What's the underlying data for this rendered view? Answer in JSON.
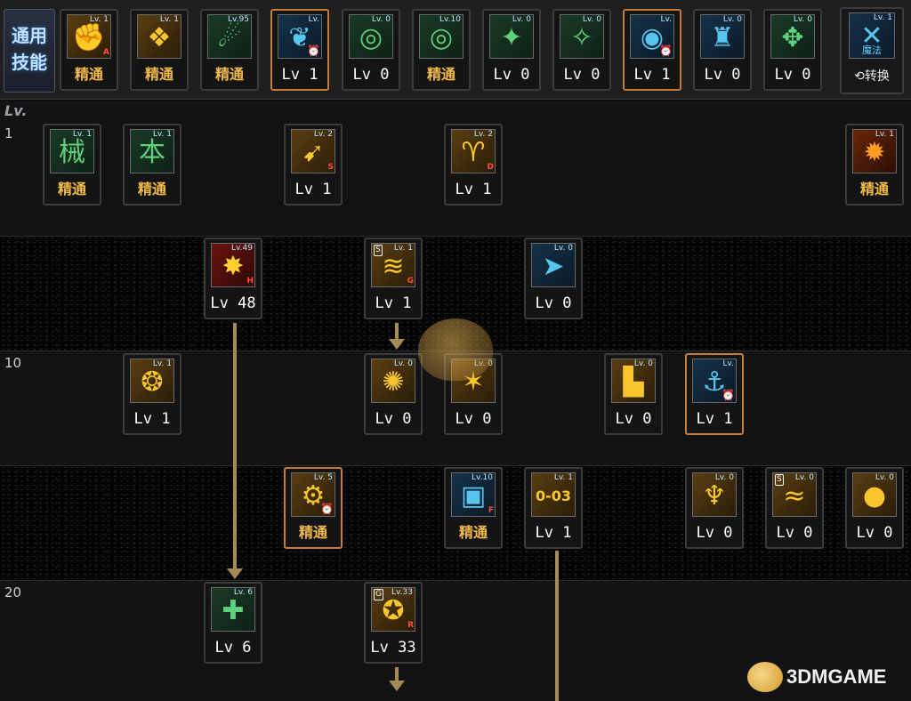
{
  "common_skills": {
    "label_line1": "通用",
    "label_line2": "技能",
    "items": [
      {
        "glyph": "✊",
        "tag": "Lv. 1",
        "letter": "A",
        "label": "精通",
        "mastery": true,
        "theme": "gold"
      },
      {
        "glyph": "❖",
        "tag": "Lv. 1",
        "letter": "",
        "label": "精通",
        "mastery": true,
        "theme": "gold"
      },
      {
        "glyph": "☄",
        "tag": "Lv.95",
        "letter": "",
        "label": "精通",
        "mastery": true,
        "theme": "green"
      },
      {
        "glyph": "❦",
        "tag": "Lv.",
        "clock": true,
        "label": "Lv 1",
        "mastery": false,
        "theme": "blue",
        "active": true
      },
      {
        "glyph": "◎",
        "tag": "Lv. 0",
        "letter": "",
        "label": "Lv 0",
        "mastery": false,
        "theme": "green"
      },
      {
        "glyph": "◎",
        "tag": "Lv.10",
        "letter": "",
        "label": "精通",
        "mastery": true,
        "theme": "green"
      },
      {
        "glyph": "✦",
        "tag": "Lv. 0",
        "letter": "",
        "label": "Lv 0",
        "mastery": false,
        "theme": "green"
      },
      {
        "glyph": "✧",
        "tag": "Lv. 0",
        "letter": "",
        "label": "Lv 0",
        "mastery": false,
        "theme": "green"
      },
      {
        "glyph": "◉",
        "tag": "Lv.",
        "clock": true,
        "label": "Lv 1",
        "mastery": false,
        "theme": "blue",
        "active": true
      },
      {
        "glyph": "♜",
        "tag": "Lv. 0",
        "letter": "",
        "label": "Lv 0",
        "mastery": false,
        "theme": "blue"
      },
      {
        "glyph": "✥",
        "tag": "Lv. 0",
        "letter": "",
        "label": "Lv 0",
        "mastery": false,
        "theme": "green"
      }
    ]
  },
  "swap": {
    "glyph": "✕",
    "tag": "Lv. 1",
    "magic": "魔法",
    "button": "⟲转换"
  },
  "tree": {
    "lv_header": "Lv.",
    "level_markers": [
      "1",
      "10",
      "20"
    ],
    "skills": [
      {
        "glyph": "械",
        "tag": "Lv. 1",
        "label": "精通",
        "mastery": true,
        "theme": "green"
      },
      {
        "glyph": "本",
        "tag": "Lv. 1",
        "label": "精通",
        "mastery": true,
        "theme": "green"
      },
      {
        "glyph": "➹",
        "tag": "Lv. 2",
        "letter": "S",
        "label": "Lv 1",
        "theme": "gold"
      },
      {
        "glyph": "♈",
        "tag": "Lv. 2",
        "letter": "D",
        "label": "Lv 1",
        "theme": "gold"
      },
      {
        "glyph": "✹",
        "tag": "Lv. 1",
        "label": "精通",
        "mastery": true,
        "theme": "fire"
      },
      {
        "glyph": "✸",
        "tag": "Lv.49",
        "letter": "H",
        "label": "Lv 48",
        "theme": "red"
      },
      {
        "glyph": "≋",
        "tag": "Lv. 1",
        "letter": "G",
        "badge": "S",
        "label": "Lv 1",
        "theme": "gold"
      },
      {
        "glyph": "➤",
        "tag": "Lv. 0",
        "label": "Lv 0",
        "theme": "blue"
      },
      {
        "glyph": "❂",
        "tag": "Lv. 1",
        "label": "Lv 1",
        "theme": "gold"
      },
      {
        "glyph": "✺",
        "tag": "Lv. 0",
        "label": "Lv 0",
        "theme": "gold"
      },
      {
        "glyph": "✶",
        "tag": "Lv. 0",
        "label": "Lv 0",
        "theme": "gold"
      },
      {
        "glyph": "▙",
        "tag": "Lv. 0",
        "label": "Lv 0",
        "theme": "gold"
      },
      {
        "glyph": "⚓",
        "tag": "Lv.",
        "clock": true,
        "label": "Lv 1",
        "theme": "blue",
        "active": true
      },
      {
        "glyph": "⚙",
        "tag": "Lv. 5",
        "clock": true,
        "label": "精通",
        "mastery": true,
        "theme": "gold",
        "active": true
      },
      {
        "glyph": "▣",
        "tag": "Lv.10",
        "letter": "F",
        "label": "精通",
        "mastery": true,
        "theme": "blue"
      },
      {
        "glyph": "0-03",
        "tag": "Lv. 1",
        "label": "Lv 1",
        "theme": "gold"
      },
      {
        "glyph": "♆",
        "tag": "Lv. 0",
        "label": "Lv 0",
        "theme": "gold"
      },
      {
        "glyph": "≈",
        "tag": "Lv. 0",
        "badge": "S",
        "label": "Lv 0",
        "theme": "gold"
      },
      {
        "glyph": "●",
        "tag": "Lv. 0",
        "label": "Lv 0",
        "theme": "gold"
      },
      {
        "glyph": "✚",
        "tag": "Lv. 6",
        "label": "Lv 6",
        "theme": "green"
      },
      {
        "glyph": "✪",
        "tag": "Lv.33",
        "letter": "R",
        "badge": "G",
        "label": "Lv 33",
        "theme": "gold"
      }
    ]
  },
  "watermark": "3DMGAME"
}
